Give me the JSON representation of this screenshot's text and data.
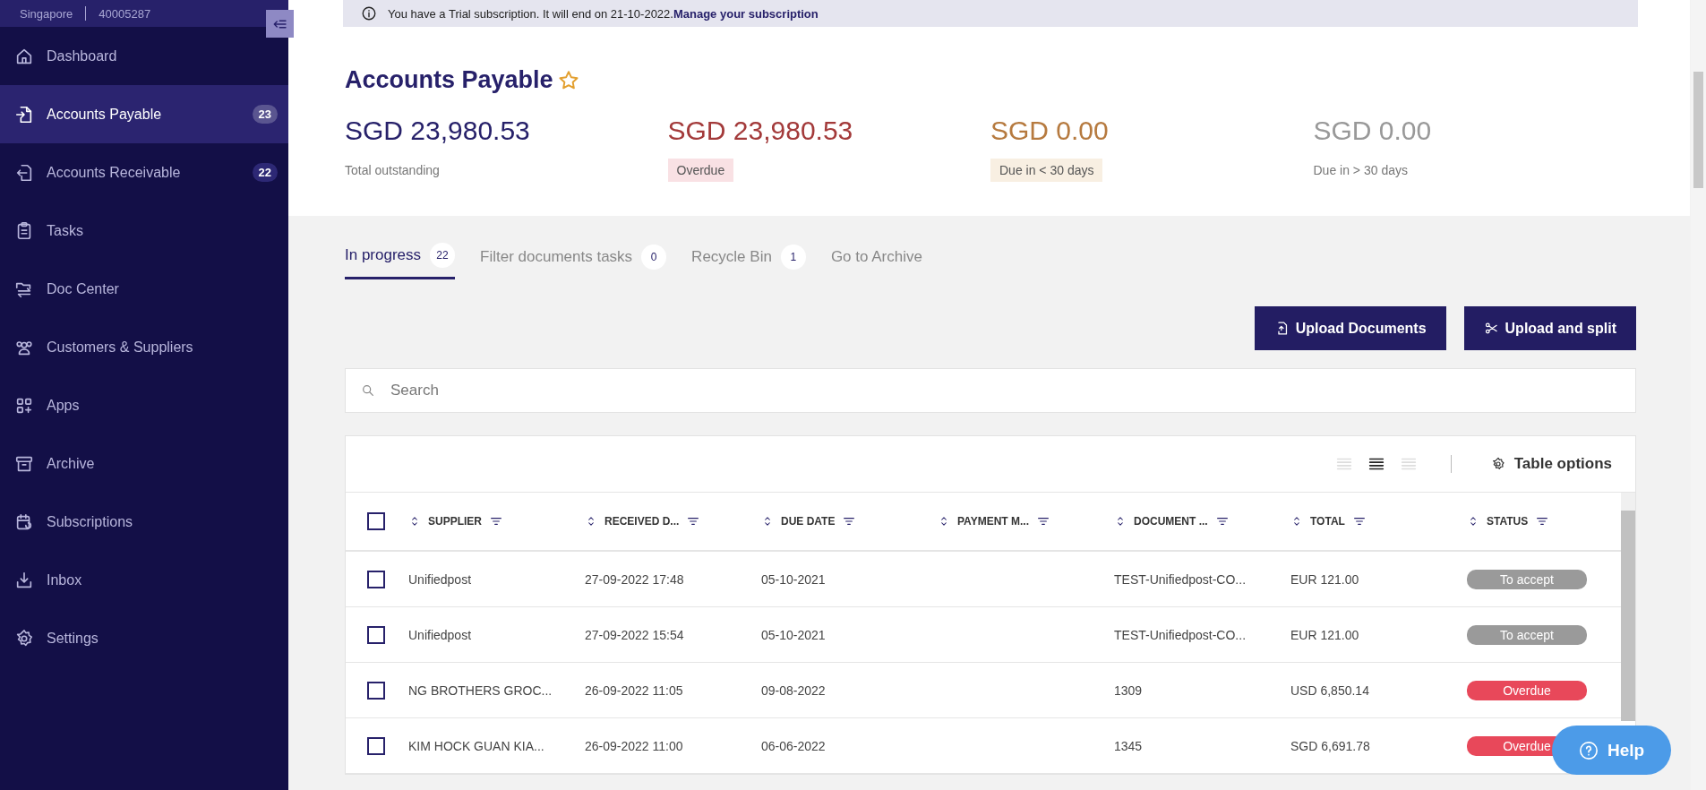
{
  "sidebar": {
    "region": "Singapore",
    "account_id": "40005287",
    "items": [
      {
        "label": "Dashboard",
        "selected": false
      },
      {
        "label": "Accounts Payable",
        "selected": true,
        "badge": "23"
      },
      {
        "label": "Accounts Receivable",
        "selected": false,
        "badge": "22"
      },
      {
        "label": "Tasks",
        "selected": false
      },
      {
        "label": "Doc Center",
        "selected": false
      },
      {
        "label": "Customers & Suppliers",
        "selected": false
      },
      {
        "label": "Apps",
        "selected": false
      },
      {
        "label": "Archive",
        "selected": false
      },
      {
        "label": "Subscriptions",
        "selected": false
      },
      {
        "label": "Inbox",
        "selected": false
      },
      {
        "label": "Settings",
        "selected": false
      }
    ]
  },
  "banner": {
    "text": "You have a Trial subscription. It will end on 21-10-2022.",
    "link": "Manage your subscription"
  },
  "page_title": "Accounts Payable",
  "favorite": false,
  "summary": [
    {
      "amount": "SGD 23,980.53",
      "label": "Total outstanding",
      "kind": "total"
    },
    {
      "amount": "SGD 23,980.53",
      "label": "Overdue",
      "kind": "overdue"
    },
    {
      "amount": "SGD 0.00",
      "label": "Due in < 30 days",
      "kind": "soon"
    },
    {
      "amount": "SGD 0.00",
      "label": "Due in > 30 days",
      "kind": "later"
    }
  ],
  "tabs": [
    {
      "label": "In progress",
      "count": "22",
      "selected": true
    },
    {
      "label": "Filter documents tasks",
      "count": "0",
      "selected": false
    },
    {
      "label": "Recycle Bin",
      "count": "1",
      "selected": false
    },
    {
      "label": "Go to Archive",
      "selected": false
    }
  ],
  "actions": [
    {
      "label": "Upload Documents",
      "kind": "upload"
    },
    {
      "label": "Upload and split",
      "kind": "split"
    }
  ],
  "search": {
    "placeholder": "Search"
  },
  "density": [
    {
      "selected": false
    },
    {
      "selected": true
    },
    {
      "selected": false
    }
  ],
  "table_options": "Table options",
  "table": {
    "select_all": {
      "checked": false
    },
    "columns": [
      "SUPPLIER",
      "RECEIVED D...",
      "DUE DATE",
      "PAYMENT M...",
      "DOCUMENT ...",
      "TOTAL",
      "STATUS"
    ],
    "rows": [
      {
        "checked": false,
        "cells": [
          "Unifiedpost",
          "27-09-2022 17:48",
          "05-10-2021",
          "",
          "TEST-Unifiedpost-CO...",
          "EUR 121.00"
        ],
        "status": {
          "label": "To accept",
          "kind": "pending"
        }
      },
      {
        "checked": false,
        "cells": [
          "Unifiedpost",
          "27-09-2022 15:54",
          "05-10-2021",
          "",
          "TEST-Unifiedpost-CO...",
          "EUR 121.00"
        ],
        "status": {
          "label": "To accept",
          "kind": "pending"
        }
      },
      {
        "checked": false,
        "cells": [
          "NG BROTHERS GROC...",
          "26-09-2022 11:05",
          "09-08-2022",
          "",
          "1309",
          "USD 6,850.14"
        ],
        "status": {
          "label": "Overdue",
          "kind": "overdue"
        }
      },
      {
        "checked": false,
        "cells": [
          "KIM HOCK GUAN KIA...",
          "26-09-2022 11:00",
          "06-06-2022",
          "",
          "1345",
          "SGD 6,691.78"
        ],
        "status": {
          "label": "Overdue",
          "kind": "overdue"
        }
      }
    ]
  },
  "help": "Help"
}
